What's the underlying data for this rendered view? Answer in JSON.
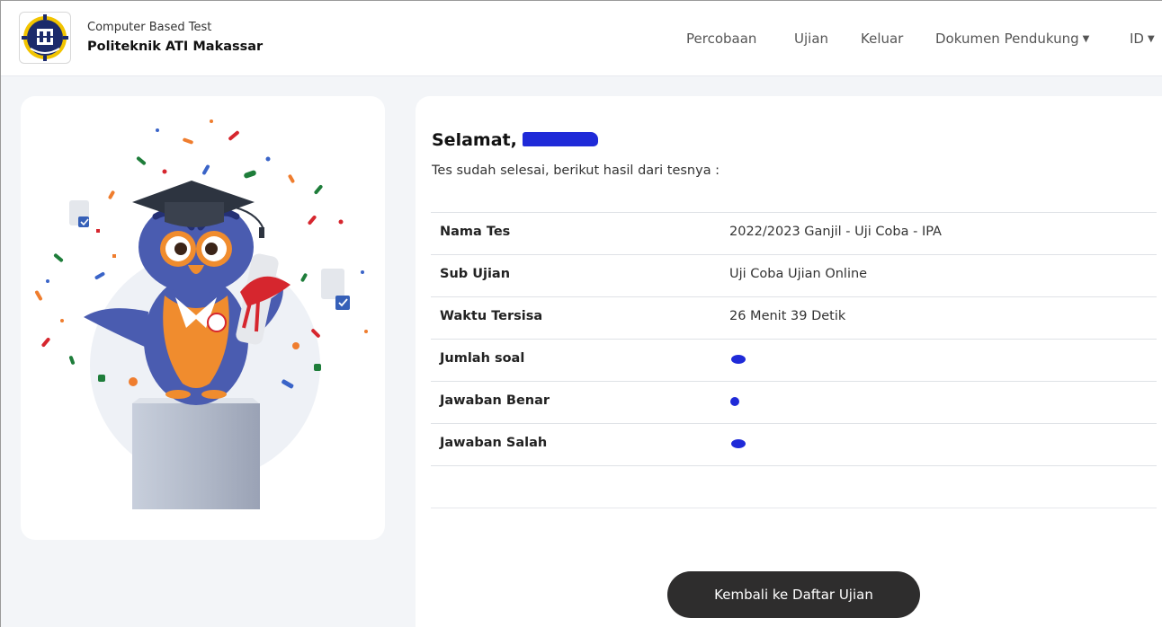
{
  "header": {
    "subtitle": "Computer Based Test",
    "title": "Politeknik ATI Makassar",
    "nav": [
      {
        "label": "Percobaan"
      },
      {
        "label": "Ujian"
      },
      {
        "label": "Keluar"
      },
      {
        "label": "Dokumen Pendukung"
      },
      {
        "label": "ID"
      }
    ]
  },
  "result": {
    "greeting": "Selamat,",
    "message": "Tes sudah selesai, berikut hasil dari tesnya :",
    "rows": [
      {
        "label": "Nama Tes",
        "value": "2022/2023 Ganjil - Uji Coba - IPA"
      },
      {
        "label": "Sub Ujian",
        "value": "Uji Coba Ujian Online"
      },
      {
        "label": "Waktu Tersisa",
        "value": "26 Menit 39 Detik"
      },
      {
        "label": "Jumlah soal",
        "value": ""
      },
      {
        "label": "Jawaban Benar",
        "value": ""
      },
      {
        "label": "Jawaban Salah",
        "value": ""
      }
    ]
  },
  "actions": {
    "back_label": "Kembali ke Daftar Ujian"
  },
  "colors": {
    "button_bg": "#2e2d2d",
    "redaction": "#1f2ad8"
  }
}
